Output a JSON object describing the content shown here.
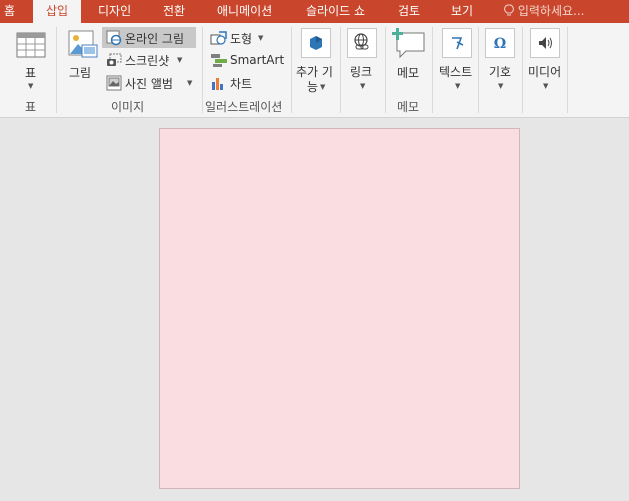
{
  "tabs": [
    "홈",
    "삽입",
    "디자인",
    "전환",
    "애니메이션",
    "슬라이드 쇼",
    "검토",
    "보기"
  ],
  "tell_me": "입력하세요...",
  "ribbon": {
    "table_label": "표",
    "table_group": "표",
    "picture_label": "그림",
    "online_picture": "온라인 그림",
    "screenshot": "스크린샷",
    "photo_album": "사진 앨범",
    "images_group": "이미지",
    "shapes": "도형",
    "smartart": "SmartArt",
    "chart": "차트",
    "illustrations_group": "일러스트레이션",
    "addins_line1": "추가 기",
    "addins_line2": "능",
    "links_label": "링크",
    "comment_label": "메모",
    "comments_group": "메모",
    "text_label": "텍스트",
    "symbols_label": "기호",
    "media_label": "미디어"
  },
  "colors": {
    "accent": "#c9462c",
    "slide_bg": "#f9dde1",
    "ribbon_bg": "#f4f4f4",
    "canvas_bg": "#e6e6e6"
  }
}
